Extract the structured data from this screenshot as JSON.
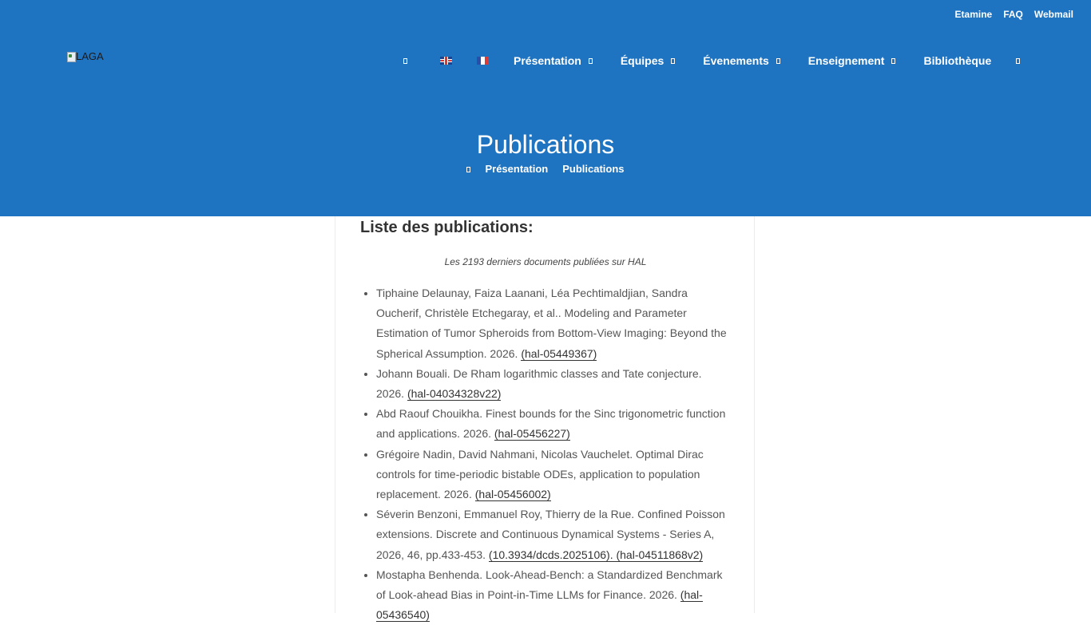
{
  "topbar": {
    "links": [
      "Etamine",
      "FAQ",
      "Webmail"
    ]
  },
  "logo": {
    "alt": "LAGA"
  },
  "nav": {
    "items": [
      "Présentation",
      "Équipes",
      "Évenements",
      "Enseignement",
      "Bibliothèque"
    ]
  },
  "header": {
    "title": "Publications",
    "breadcrumb": [
      "Présentation",
      "Publications"
    ]
  },
  "content": {
    "heading": "Liste des publications:",
    "subtitle": "Les 2193 derniers documents publiées sur HAL",
    "publications": [
      {
        "text": "Tiphaine Delaunay, Faiza Laanani, Léa Pechtimaldjian, Sandra Oucherif, Christèle Etchegaray, et al.. Modeling and Parameter Estimation of Tumor Spheroids from Bottom-View Imaging: Beyond the Spherical Assumption. 2026. ",
        "link": "(hal-05449367)"
      },
      {
        "text": "Johann Bouali. De Rham logarithmic classes and Tate conjecture. 2026. ",
        "link": "(hal-04034328v22)"
      },
      {
        "text": "Abd Raouf Chouikha. Finest bounds for the Sinc trigonometric function and applications. 2026. ",
        "link": "(hal-05456227)"
      },
      {
        "text": "Grégoire Nadin, David Nahmani, Nicolas Vauchelet. Optimal Dirac controls for time-periodic bistable ODEs, application to population replacement. 2026. ",
        "link": "(hal-05456002)"
      },
      {
        "text": "Séverin Benzoni, Emmanuel Roy, Thierry de la Rue. Confined Poisson extensions. Discrete and Continuous Dynamical Systems - Series A, 2026, 46, pp.433-453. ",
        "link": "(10.3934/dcds.2025106). (hal-04511868v2)"
      },
      {
        "text": "Mostapha Benhenda. Look-Ahead-Bench: a Standardized Benchmark of Look-ahead Bias in Point-in-Time LLMs for Finance. 2026. ",
        "link": "(hal-05436540)"
      }
    ]
  }
}
